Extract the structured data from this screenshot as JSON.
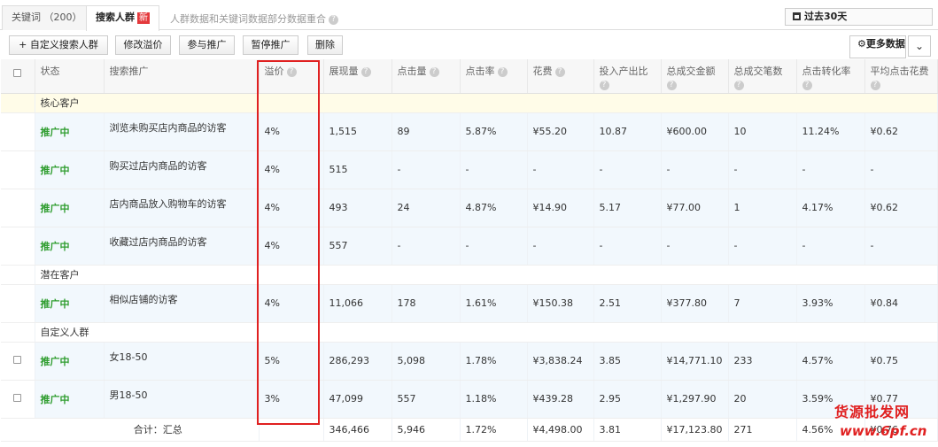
{
  "tabs": [
    {
      "label": "关键词 （200）"
    },
    {
      "label": "搜索人群",
      "badge": "新"
    }
  ],
  "tab_note": "人群数据和关键词数据部分数据重合",
  "date_range": "过去30天",
  "toolbar": {
    "add_custom": "+ 自定义搜索人群",
    "modify_premium": "修改溢价",
    "join": "参与推广",
    "pause": "暂停推广",
    "delete": "删除",
    "more": "更多数据"
  },
  "columns": [
    "状态",
    "搜索推广",
    "溢价",
    "展现量",
    "点击量",
    "点击率",
    "花费",
    "投入产出比",
    "总成交金额",
    "总成交笔数",
    "点击转化率",
    "平均点击花费"
  ],
  "groups": [
    {
      "name": "核心客户",
      "rows": [
        {
          "status": "推广中",
          "audience": "浏览未购买店内商品的访客",
          "premium": "4%",
          "impressions": "1,515",
          "clicks": "89",
          "ctr": "5.87%",
          "cost": "¥55.20",
          "roi": "10.87",
          "gmv": "¥600.00",
          "orders": "10",
          "cvr": "11.24%",
          "cpc": "¥0.62"
        },
        {
          "status": "推广中",
          "audience": "购买过店内商品的访客",
          "premium": "4%",
          "impressions": "515",
          "clicks": "-",
          "ctr": "-",
          "cost": "-",
          "roi": "-",
          "gmv": "-",
          "orders": "-",
          "cvr": "-",
          "cpc": "-"
        },
        {
          "status": "推广中",
          "audience": "店内商品放入购物车的访客",
          "premium": "4%",
          "impressions": "493",
          "clicks": "24",
          "ctr": "4.87%",
          "cost": "¥14.90",
          "roi": "5.17",
          "gmv": "¥77.00",
          "orders": "1",
          "cvr": "4.17%",
          "cpc": "¥0.62"
        },
        {
          "status": "推广中",
          "audience": "收藏过店内商品的访客",
          "premium": "4%",
          "impressions": "557",
          "clicks": "-",
          "ctr": "-",
          "cost": "-",
          "roi": "-",
          "gmv": "-",
          "orders": "-",
          "cvr": "-",
          "cpc": "-"
        }
      ]
    },
    {
      "name": "潜在客户",
      "rows": [
        {
          "status": "推广中",
          "audience": "相似店铺的访客",
          "premium": "4%",
          "impressions": "11,066",
          "clicks": "178",
          "ctr": "1.61%",
          "cost": "¥150.38",
          "roi": "2.51",
          "gmv": "¥377.80",
          "orders": "7",
          "cvr": "3.93%",
          "cpc": "¥0.84"
        }
      ]
    },
    {
      "name": "自定义人群",
      "rows": [
        {
          "status": "推广中",
          "audience": "女18-50",
          "premium": "5%",
          "impressions": "286,293",
          "clicks": "5,098",
          "ctr": "1.78%",
          "cost": "¥3,838.24",
          "roi": "3.85",
          "gmv": "¥14,771.10",
          "orders": "233",
          "cvr": "4.57%",
          "cpc": "¥0.75"
        },
        {
          "status": "推广中",
          "audience": "男18-50",
          "premium": "3%",
          "impressions": "47,099",
          "clicks": "557",
          "ctr": "1.18%",
          "cost": "¥439.28",
          "roi": "2.95",
          "gmv": "¥1,297.90",
          "orders": "20",
          "cvr": "3.59%",
          "cpc": "¥0.77"
        }
      ]
    }
  ],
  "total": {
    "label": "合计：汇总",
    "impressions": "346,466",
    "clicks": "5,946",
    "ctr": "1.72%",
    "cost": "¥4,498.00",
    "roi": "3.81",
    "gmv": "¥17,123.80",
    "orders": "271",
    "cvr": "4.56%",
    "cpc": "¥0.76"
  },
  "watermark": {
    "line1": "货源批发网",
    "line2": "www.6pf.cn"
  },
  "colors": {
    "status_green": "#2f9d2f",
    "highlight_red": "#e02020",
    "row_bg": "#f2f8fd",
    "group_bg": "#fffce8"
  }
}
